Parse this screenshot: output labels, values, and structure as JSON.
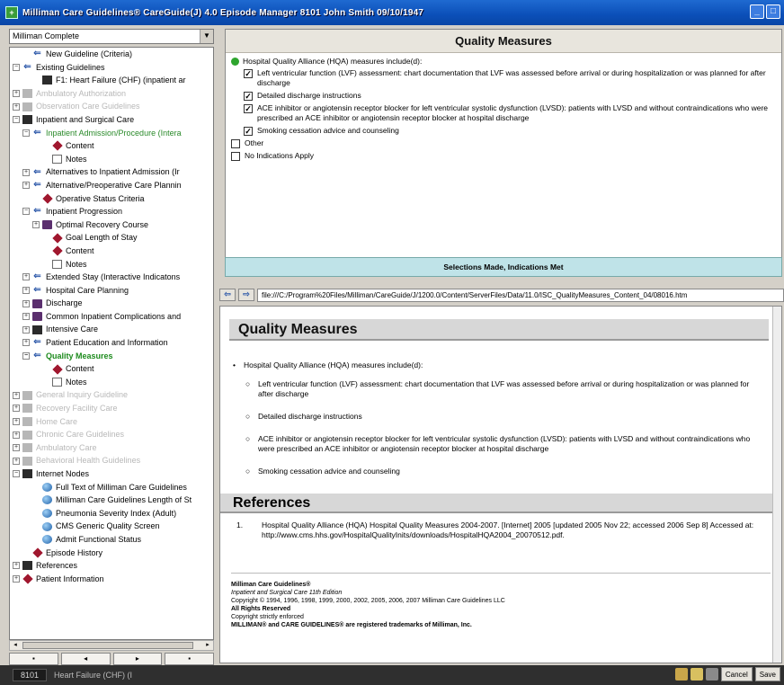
{
  "window": {
    "title": "Milliman Care Guidelines® CareGuide(J) 4.0 Episode Manager    8101    John Smith    09/10/1947",
    "buttons": [
      "_",
      "□"
    ]
  },
  "sidebar": {
    "combo_value": "Milliman Complete",
    "tree": [
      {
        "label": "New Guideline (Criteria)",
        "icon": "arrow-icon",
        "exp": "",
        "indent": 1,
        "style": "normal"
      },
      {
        "label": "Existing Guidelines",
        "icon": "arrow-icon",
        "exp": "−",
        "indent": 0,
        "style": "normal"
      },
      {
        "label": "F1: Heart Failure (CHF) (inpatient ar",
        "icon": "book-dark",
        "exp": "",
        "indent": 2,
        "style": "normal"
      },
      {
        "label": "Ambulatory Authorization",
        "icon": "grey-book",
        "exp": "+",
        "indent": 0,
        "style": "grey"
      },
      {
        "label": "Observation Care Guidelines",
        "icon": "grey-book",
        "exp": "+",
        "indent": 0,
        "style": "grey"
      },
      {
        "label": "Inpatient and Surgical Care",
        "icon": "book-dark",
        "exp": "−",
        "indent": 0,
        "style": "normal"
      },
      {
        "label": "Inpatient Admission/Procedure (Intera",
        "icon": "arrow-icon",
        "exp": "−",
        "indent": 1,
        "style": "green"
      },
      {
        "label": "Content",
        "icon": "diamond",
        "exp": "",
        "indent": 3,
        "style": "normal"
      },
      {
        "label": "Notes",
        "icon": "note",
        "exp": "",
        "indent": 3,
        "style": "normal"
      },
      {
        "label": "Alternatives to Inpatient Admission (Ir",
        "icon": "arrow-icon",
        "exp": "+",
        "indent": 1,
        "style": "normal"
      },
      {
        "label": "Alternative/Preoperative Care Plannin",
        "icon": "arrow-icon",
        "exp": "+",
        "indent": 1,
        "style": "normal"
      },
      {
        "label": "Operative Status Criteria",
        "icon": "diamond",
        "exp": "",
        "indent": 2,
        "style": "normal"
      },
      {
        "label": "Inpatient Progression",
        "icon": "arrow-icon",
        "exp": "−",
        "indent": 1,
        "style": "normal"
      },
      {
        "label": "Optimal Recovery Course",
        "icon": "book",
        "exp": "+",
        "indent": 2,
        "style": "normal"
      },
      {
        "label": "Goal Length of Stay",
        "icon": "diamond",
        "exp": "",
        "indent": 3,
        "style": "normal"
      },
      {
        "label": "Content",
        "icon": "diamond",
        "exp": "",
        "indent": 3,
        "style": "normal"
      },
      {
        "label": "Notes",
        "icon": "note",
        "exp": "",
        "indent": 3,
        "style": "normal"
      },
      {
        "label": "Extended Stay (Interactive Indicatons",
        "icon": "arrow-icon",
        "exp": "+",
        "indent": 1,
        "style": "normal"
      },
      {
        "label": "Hospital Care Planning",
        "icon": "arrow-icon",
        "exp": "+",
        "indent": 1,
        "style": "normal"
      },
      {
        "label": "Discharge",
        "icon": "book",
        "exp": "+",
        "indent": 1,
        "style": "normal"
      },
      {
        "label": "Common Inpatient Complications and",
        "icon": "book",
        "exp": "+",
        "indent": 1,
        "style": "normal"
      },
      {
        "label": "Intensive Care",
        "icon": "book-dark",
        "exp": "+",
        "indent": 1,
        "style": "normal"
      },
      {
        "label": "Patient Education and Information",
        "icon": "arrow-icon",
        "exp": "+",
        "indent": 1,
        "style": "normal"
      },
      {
        "label": "Quality Measures",
        "icon": "arrow-icon",
        "exp": "−",
        "indent": 1,
        "style": "selected"
      },
      {
        "label": "Content",
        "icon": "diamond",
        "exp": "",
        "indent": 3,
        "style": "normal"
      },
      {
        "label": "Notes",
        "icon": "note",
        "exp": "",
        "indent": 3,
        "style": "normal"
      },
      {
        "label": "General Inquiry Guideline",
        "icon": "grey-book",
        "exp": "+",
        "indent": 0,
        "style": "grey"
      },
      {
        "label": "Recovery Facility Care",
        "icon": "grey-book",
        "exp": "+",
        "indent": 0,
        "style": "grey"
      },
      {
        "label": "Home Care",
        "icon": "grey-book",
        "exp": "+",
        "indent": 0,
        "style": "grey"
      },
      {
        "label": "Chronic Care Guidelines",
        "icon": "grey-book",
        "exp": "+",
        "indent": 0,
        "style": "grey"
      },
      {
        "label": "Ambulatory Care",
        "icon": "grey-book",
        "exp": "+",
        "indent": 0,
        "style": "grey"
      },
      {
        "label": "Behavioral Health Guidelines",
        "icon": "grey-book",
        "exp": "+",
        "indent": 0,
        "style": "grey"
      },
      {
        "label": "Internet Nodes",
        "icon": "book-dark",
        "exp": "−",
        "indent": 0,
        "style": "normal"
      },
      {
        "label": "Full Text of Milliman Care Guidelines",
        "icon": "globe",
        "exp": "",
        "indent": 2,
        "style": "normal"
      },
      {
        "label": "Milliman Care Guidelines Length of St",
        "icon": "globe",
        "exp": "",
        "indent": 2,
        "style": "normal"
      },
      {
        "label": "Pneumonia Severity Index (Adult)",
        "icon": "globe",
        "exp": "",
        "indent": 2,
        "style": "normal"
      },
      {
        "label": "CMS Generic Quality Screen",
        "icon": "globe",
        "exp": "",
        "indent": 2,
        "style": "normal"
      },
      {
        "label": "Admit Functional Status",
        "icon": "globe",
        "exp": "",
        "indent": 2,
        "style": "normal"
      },
      {
        "label": "Episode History",
        "icon": "diamond",
        "exp": "",
        "indent": 1,
        "style": "normal"
      },
      {
        "label": "References",
        "icon": "book-dark",
        "exp": "+",
        "indent": 0,
        "style": "normal"
      },
      {
        "label": "Patient Information",
        "icon": "diamond",
        "exp": "+",
        "indent": 0,
        "style": "normal"
      }
    ],
    "nav_buttons": [
      "▪",
      "◂",
      "▸",
      "▪"
    ]
  },
  "quality_panel": {
    "title": "Quality Measures",
    "lead": "Hospital Quality Alliance (HQA) measures include(d):",
    "items": [
      {
        "checked": true,
        "text": "Left ventricular function (LVF) assessment: chart documentation that LVF was assessed before arrival or during hospitalization or was planned for after discharge"
      },
      {
        "checked": true,
        "text": "Detailed discharge instructions"
      },
      {
        "checked": true,
        "text": "ACE inhibitor or angiotensin receptor blocker for left ventricular systolic dysfunction (LVSD): patients with LVSD and without contraindications who were prescribed an ACE inhibitor or angiotensin receptor blocker at hospital discharge"
      },
      {
        "checked": true,
        "text": "Smoking cessation advice and counseling"
      }
    ],
    "other_label": "Other",
    "no_indications_label": "No Indications Apply",
    "status": "Selections Made, Indications Met"
  },
  "address_bar": {
    "url": "file:///C:/Program%20Files/Milliman/CareGuide/J/1200.0/Content/ServerFiles/Data/11.0/ISC_QualityMeasures_Content_04/08016.htm",
    "back": "⇦",
    "forward": "⇨"
  },
  "document": {
    "heading": "Quality Measures",
    "lead": "Hospital Quality Alliance (HQA) measures include(d):",
    "items": [
      "Left ventricular function (LVF) assessment: chart documentation that LVF was assessed before arrival or during hospitalization or was planned for after discharge",
      "Detailed discharge instructions",
      "ACE inhibitor or angiotensin receptor blocker for left ventricular systolic dysfunction (LVSD): patients with LVSD and without contraindications who were prescribed an ACE inhibitor or angiotensin receptor blocker at hospital discharge",
      "Smoking cessation advice and counseling"
    ],
    "references_heading": "References",
    "ref_num": "1.",
    "reference": "Hospital Quality Alliance (HQA) Hospital Quality Measures 2004-2007. [Internet] 2005 [updated 2005 Nov 22; accessed 2006 Sep 8] Accessed at: http://www.cms.hhs.gov/HospitalQualityInits/downloads/HospitalHQA2004_20070512.pdf.",
    "footer": [
      "Milliman Care Guidelines®",
      "Inpatient and Surgical Care 11th Edition",
      "Copyright © 1994, 1996, 1998, 1999, 2000, 2002, 2005, 2006, 2007 Milliman Care Guidelines LLC",
      "All Rights Reserved",
      "Copyright strictly enforced",
      "MILLIMAN® and CARE GUIDELINES® are registered trademarks of Milliman, Inc."
    ]
  },
  "statusbar": {
    "id": "8101",
    "label": "Heart Failure (CHF) (I",
    "cancel": "Cancel",
    "save": "Save"
  }
}
